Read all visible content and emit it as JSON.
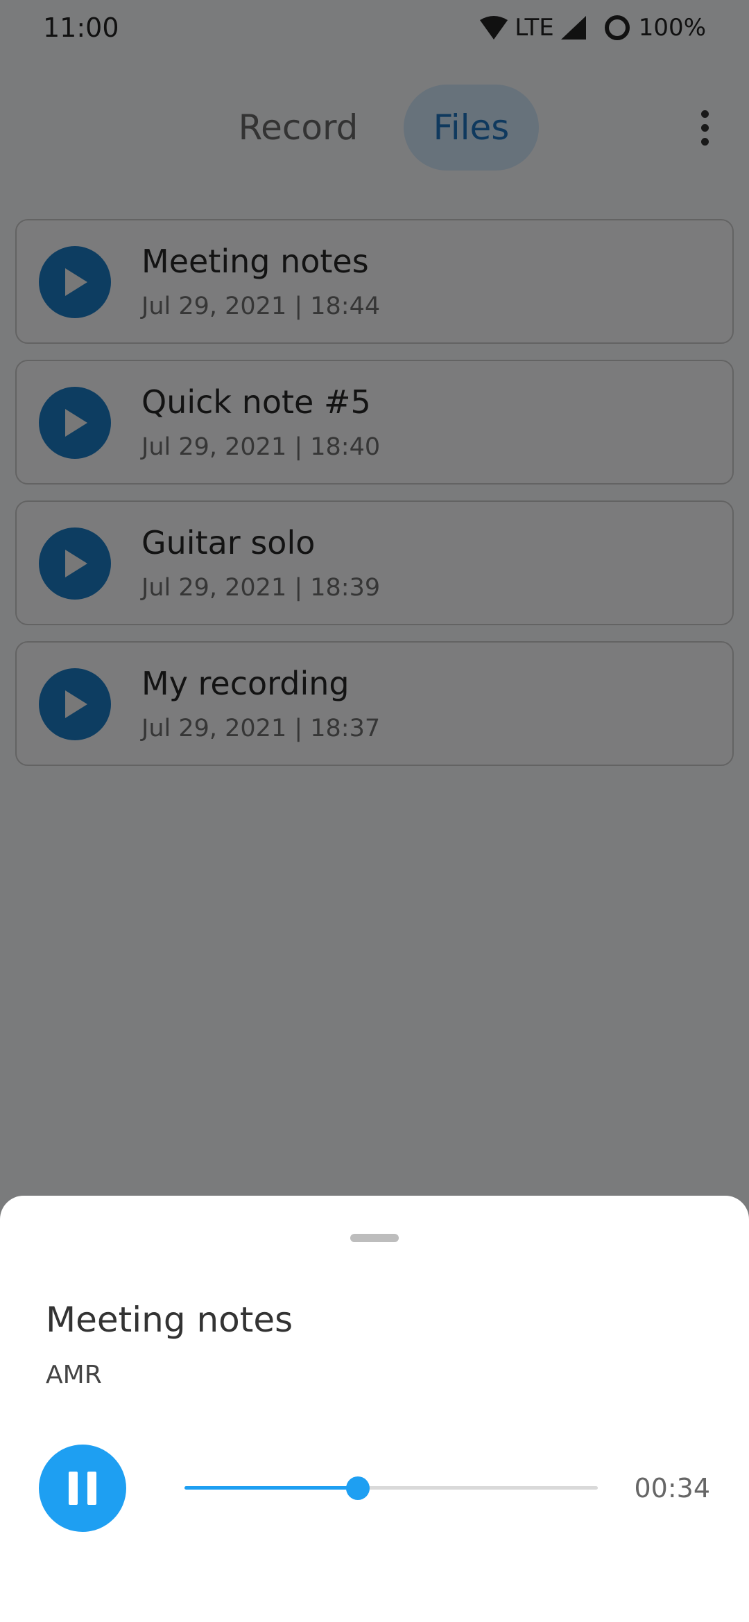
{
  "status_bar": {
    "time": "11:00",
    "network": "LTE",
    "battery": "100%",
    "icons": [
      "wifi-icon",
      "signal-icon",
      "battery-icon"
    ]
  },
  "tabs": [
    {
      "label": "Record",
      "active": false
    },
    {
      "label": "Files",
      "active": true
    }
  ],
  "files": [
    {
      "title": "Meeting notes",
      "date": "Jul 29, 2021 | 18:44"
    },
    {
      "title": "Quick note #5",
      "date": "Jul 29, 2021 | 18:40"
    },
    {
      "title": "Guitar solo",
      "date": "Jul 29, 2021 | 18:39"
    },
    {
      "title": "My recording",
      "date": "Jul 29, 2021 | 18:37"
    }
  ],
  "player": {
    "title": "Meeting notes",
    "format": "AMR",
    "elapsed": "00:34",
    "progress": 0.42,
    "state": "playing"
  },
  "colors": {
    "accent": "#1e9ff2",
    "play_button": "#1a7ac3",
    "tab_active_bg": "#cfe4f6",
    "tab_active_text": "#1e73bd"
  }
}
